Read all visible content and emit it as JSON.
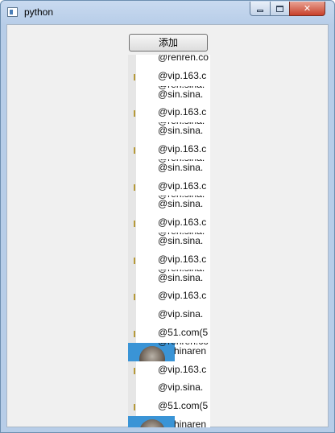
{
  "window": {
    "title": "python"
  },
  "toolbar": {
    "add_label": "添加"
  },
  "list": {
    "rows": [
      {
        "text": "@renren.co",
        "partial": true
      },
      {
        "text": "@vip.163.c"
      },
      {
        "text": "@sin.sina.",
        "ghost": "@ren.sina."
      },
      {
        "text": "@vip.163.c"
      },
      {
        "text": "@sin.sina.",
        "ghost": "@ren.sina."
      },
      {
        "text": "@vip.163.c"
      },
      {
        "text": "@sin.sina.",
        "ghost": "@ren.sina."
      },
      {
        "text": "@vip.163.c"
      },
      {
        "text": "@sin.sina.",
        "ghost": "@ren.sina."
      },
      {
        "text": "@vip.163.c"
      },
      {
        "text": "@sin.sina.",
        "ghost": "@ren.sina."
      },
      {
        "text": "@vip.163.c"
      },
      {
        "text": "@sin.sina.",
        "ghost": "@ren.sina."
      },
      {
        "text": "@vip.163.c"
      },
      {
        "text": "@vip.sina."
      },
      {
        "text": "@51.com(5"
      },
      {
        "text": "hinaren",
        "avatar": true,
        "ghost": "@renren.co"
      },
      {
        "text": "@vip.163.c"
      },
      {
        "text": "@vip.sina."
      },
      {
        "text": "@51.com(5"
      },
      {
        "text": "hinaren",
        "avatar": true
      }
    ]
  }
}
